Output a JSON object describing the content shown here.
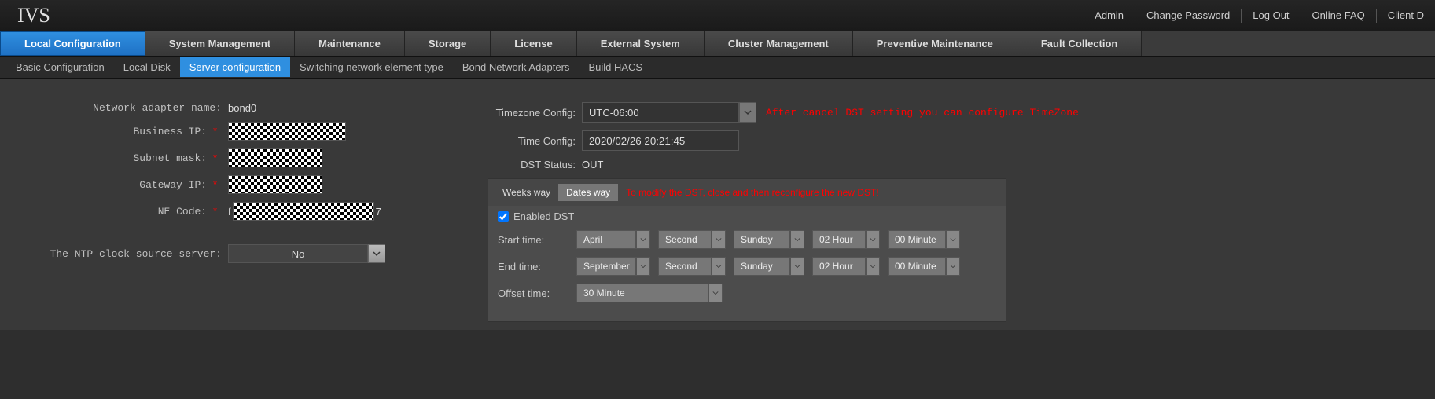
{
  "brand": "IVS",
  "top_links": {
    "admin": "Admin",
    "change_pw": "Change Password",
    "logout": "Log Out",
    "faq": "Online FAQ",
    "client": "Client D"
  },
  "main_tabs": {
    "local_config": "Local Configuration",
    "system_mgmt": "System Management",
    "maintenance": "Maintenance",
    "storage": "Storage",
    "license": "License",
    "external": "External System",
    "cluster": "Cluster Management",
    "preventive": "Preventive Maintenance",
    "fault": "Fault Collection"
  },
  "sub_tabs": {
    "basic": "Basic Configuration",
    "disk": "Local Disk",
    "server": "Server configuration",
    "switching": "Switching network element type",
    "bond": "Bond Network Adapters",
    "hacs": "Build HACS"
  },
  "left": {
    "adapter_label": "Network adapter name:",
    "adapter_value": "bond0",
    "business_ip_label": "Business IP:",
    "subnet_label": "Subnet mask:",
    "gateway_label": "Gateway IP:",
    "ne_label": "NE Code:",
    "ne_value_prefix": "f",
    "ne_value_suffix": "7",
    "ntp_label": "The NTP clock source server:",
    "ntp_value": "No"
  },
  "right": {
    "tz_label": "Timezone Config:",
    "tz_value": "UTC-06:00",
    "tz_hint": "After cancel DST setting you can configure TimeZone",
    "time_label": "Time Config:",
    "time_value": "2020/02/26 20:21:45",
    "dst_status_label": "DST Status:",
    "dst_status_value": "OUT",
    "tabs": {
      "weeks": "Weeks way",
      "dates": "Dates way"
    },
    "tabs_hint": "To modify the DST, close and then reconfigure the new DST!",
    "enabled_label": "Enabled DST",
    "enabled_checked": true,
    "start_label": "Start time:",
    "end_label": "End time:",
    "offset_label": "Offset time:",
    "start": {
      "month": "April",
      "ord": "Second",
      "day": "Sunday",
      "hour": "02 Hour",
      "min": "00 Minute"
    },
    "end": {
      "month": "September",
      "ord": "Second",
      "day": "Sunday",
      "hour": "02 Hour",
      "min": "00 Minute"
    },
    "offset": "30 Minute"
  }
}
